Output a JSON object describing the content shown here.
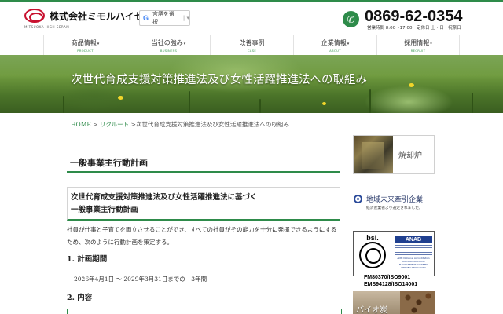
{
  "header": {
    "company_name": "株式会社ミモルハイセラム",
    "logo_sub": "MITSUOKA HIGH SERAM",
    "translate_label": "言語を選択",
    "phone": "0869-62-0354",
    "hours": "営業時間 8:00〜17:00　定休日 土・日・祝祭日"
  },
  "nav": {
    "items": [
      {
        "label": "商品情報",
        "en": "PRODUCT",
        "has_dropdown": true
      },
      {
        "label": "当社の強み",
        "en": "BUSINESS",
        "has_dropdown": true
      },
      {
        "label": "改善事例",
        "en": "CASE",
        "has_dropdown": false
      },
      {
        "label": "企業情報",
        "en": "ABOUT",
        "has_dropdown": true
      },
      {
        "label": "採用情報",
        "en": "RECRUIT",
        "has_dropdown": true
      }
    ]
  },
  "hero": {
    "title": "次世代育成支援対策推進法及び女性活躍推進法への取組み"
  },
  "breadcrumb": {
    "home": "HOME",
    "sep1": " > ",
    "recruit": "リクルート",
    "sep2": " >",
    "current": "次世代育成支援対策推進法及び女性活躍推進法への取組み"
  },
  "main": {
    "heading": "一般事業主行動計画",
    "box_line1": "次世代育成支援対策推進法及び女性活躍推進法に基づく",
    "box_line2": "一般事業主行動計画",
    "paragraph": "社員が仕事と子育てを両立させることができ、すべての社員がその能力を十分に発揮できるようにするため、次のように行動計画を策定する。",
    "section1_title": "1. 計画期間",
    "period": "2026年4月1日 〜 2029年3月31日までの　3年間",
    "section2_title": "2. 内容"
  },
  "sidebar": {
    "banner1_label": "焼却炉",
    "banner2_title": "地域未来牽引企業",
    "banner2_sub": "経済産業省より選定されました。",
    "bsi_label": "bsi.",
    "anab_label": "ANAB",
    "anab_small": "ANSI National Accreditation Board ACCREDITED MANAGEMENT SYSTEMS CERTIFICATION BODY",
    "cert1": "FM80370/ISO9001",
    "cert2": "EMS94128/ISO14001",
    "banner4_label": "バイオ炭"
  },
  "colors": {
    "accent_green": "#2e8b4a",
    "logo_red": "#c8102e",
    "anab_blue": "#1f3f8f"
  }
}
